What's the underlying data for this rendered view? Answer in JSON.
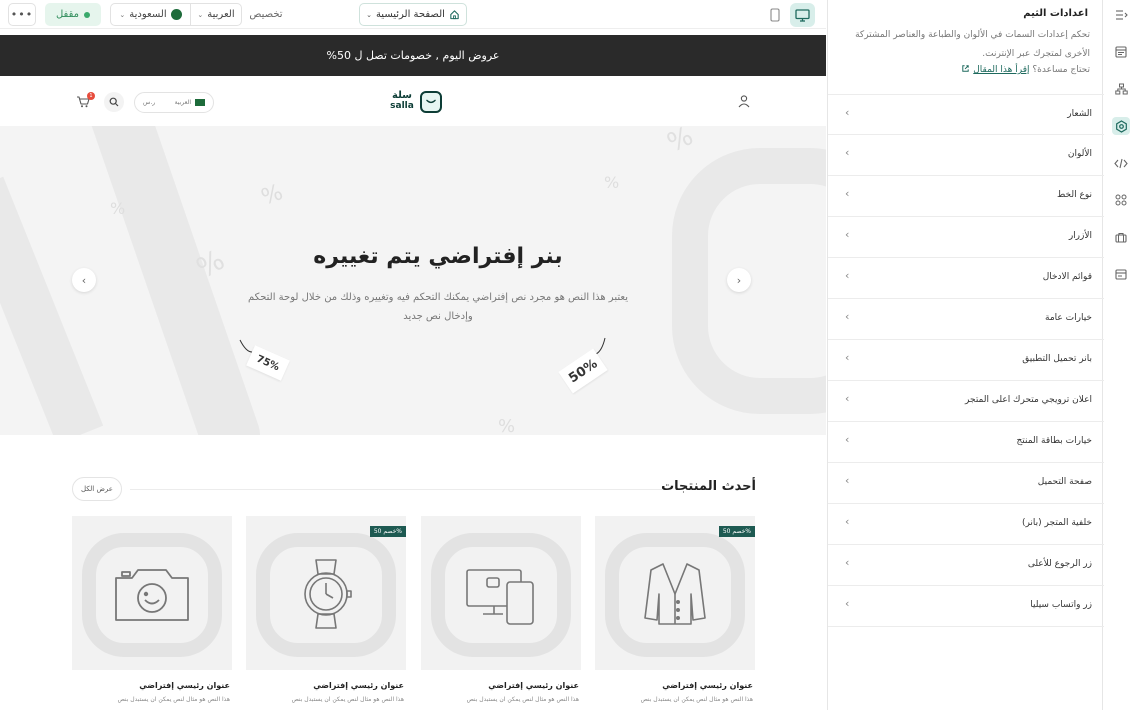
{
  "toolbar": {
    "more_label": "•••",
    "status_label": "مقفل",
    "country_label": "السعودية",
    "language_label": "العربية",
    "customize_label": "تخصيص",
    "page_select_label": "الصفحة الرئيسية"
  },
  "store": {
    "announcement": "عروض اليوم , خصومات تصل ل 50%",
    "header": {
      "cart_count": "1",
      "currency": "ر.س",
      "language": "العربية",
      "logo_ar": "سلة",
      "logo_en": "salla"
    },
    "hero": {
      "title": "بنر إفتراضي يتم تغييره",
      "subtitle": "يعتبر هذا النص هو مجرد نص إفتراضي يمكنك التحكم فيه وتغييره وذلك من خلال لوحة التحكم وإدخال نص جديد",
      "tag_left": "75%",
      "tag_right": "50%",
      "arrow_left": "‹",
      "arrow_right": "›"
    },
    "latest": {
      "title": "أحدث المنتجات",
      "view_all": "عرض الكل"
    },
    "products": [
      {
        "badge": "خصم 50%",
        "title": "عنوان رئيسي إفتراضي",
        "desc": "هذا النص هو مثال لنص يمكن ان يستبدل بنص",
        "icon": "cardigan-icon"
      },
      {
        "badge": "",
        "title": "عنوان رئيسي إفتراضي",
        "desc": "هذا النص هو مثال لنص يمكن ان يستبدل بنص",
        "icon": "devices-icon"
      },
      {
        "badge": "خصم 50%",
        "title": "عنوان رئيسي إفتراضي",
        "desc": "هذا النص هو مثال لنص يمكن ان يستبدل بنص",
        "icon": "watch-icon"
      },
      {
        "badge": "",
        "title": "عنوان رئيسي إفتراضي",
        "desc": "هذا النص هو مثال لنص يمكن ان يستبدل بنص",
        "icon": "camera-icon"
      }
    ]
  },
  "panel": {
    "title": "اعدادات الثيم",
    "description": "تحكم إعدادات السمات في الألوان والطباعة والعناصر المشتركة الأخرى لمتجرك عبر الإنترنت.",
    "help_prefix": "تحتاج مساعدة؟",
    "help_link": "إقرأ هذا المقال",
    "items": [
      {
        "label": "الشعار"
      },
      {
        "label": "الألوان"
      },
      {
        "label": "نوع الخط"
      },
      {
        "label": "الأزرار"
      },
      {
        "label": "قوائم الادخال"
      },
      {
        "label": "خيارات عامة"
      },
      {
        "label": "بانر تحميل التطبيق"
      },
      {
        "label": "اعلان ترويجي متحرك اعلى المتجر"
      },
      {
        "label": "خيارات بطاقة المنتج"
      },
      {
        "label": "صفحة التحميل"
      },
      {
        "label": "خلفية المتجر (بانر)"
      },
      {
        "label": "زر الرجوع للأعلى"
      },
      {
        "label": "زر واتساب سيليا"
      }
    ]
  },
  "rail": {
    "icons": [
      "collapse-panel-icon",
      "layout-icon",
      "sitemap-icon",
      "theme-settings-icon",
      "code-icon",
      "components-icon",
      "briefcase-icon",
      "card-icon"
    ],
    "active": "theme-settings-icon"
  },
  "colors": {
    "accent": "#1e6a5e",
    "accent_light": "#d8eeea",
    "status_green": "#39a96b",
    "announcement_bg": "#2a2a2a",
    "badge_bg": "#1e5a52"
  }
}
